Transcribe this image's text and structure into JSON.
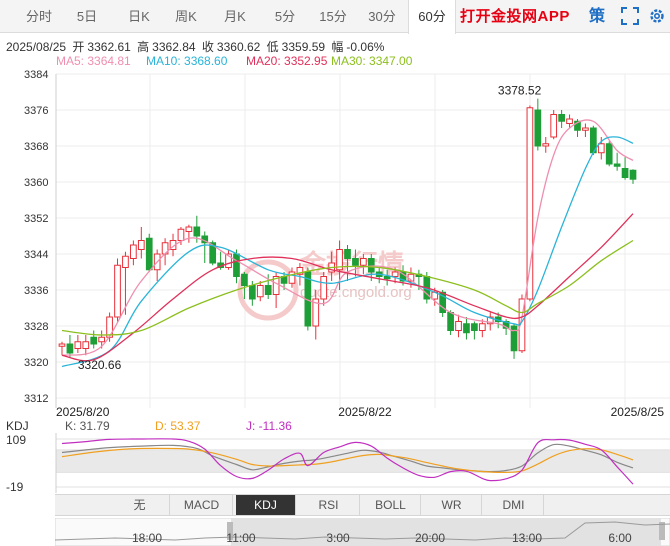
{
  "tabs": [
    {
      "label": "分时",
      "active": false
    },
    {
      "label": "5日",
      "active": false
    },
    {
      "label": "日K",
      "active": false
    },
    {
      "label": "周K",
      "active": false
    },
    {
      "label": "月K",
      "active": false
    },
    {
      "label": "5分",
      "active": false
    },
    {
      "label": "15分",
      "active": false
    },
    {
      "label": "30分",
      "active": false
    },
    {
      "label": "60分",
      "active": true
    }
  ],
  "header": {
    "app_link": "打开金投网APP",
    "strategy": "策",
    "fullscreen_icon": "fullscreen-icon",
    "settings_icon": "gear-icon"
  },
  "quote": {
    "date": "2025/08/25",
    "open_label": "开",
    "open": "3362.61",
    "high_label": "高",
    "high": "3362.84",
    "close_label": "收",
    "close": "3360.62",
    "low_label": "低",
    "low": "3359.59",
    "change_label": "幅",
    "change": "-0.06%"
  },
  "ma": [
    {
      "label": "MA5: 3364.81",
      "color": "#ef8fb0"
    },
    {
      "label": "MA10: 3368.60",
      "color": "#2ab4d8"
    },
    {
      "label": "MA20: 3352.95",
      "color": "#e0305a"
    },
    {
      "label": "MA30: 3347.00",
      "color": "#8cbf1e"
    }
  ],
  "watermark": {
    "text1": "金投行情",
    "text2": "quote.cngold.org"
  },
  "kdj": {
    "title": "KDJ",
    "k": "K: 31.79",
    "k_color": "#888888",
    "d": "D: 53.37",
    "d_color": "#f0a020",
    "j": "J: -11.36",
    "j_color": "#c030c0",
    "ymax": "109",
    "ymin": "-19"
  },
  "indicators": [
    {
      "label": "无",
      "active": false
    },
    {
      "label": "MACD",
      "active": false
    },
    {
      "label": "KDJ",
      "active": true
    },
    {
      "label": "RSI",
      "active": false
    },
    {
      "label": "BOLL",
      "active": false
    },
    {
      "label": "WR",
      "active": false
    },
    {
      "label": "DMI",
      "active": false
    }
  ],
  "nav_arrows": {
    "up": "▲",
    "down": "▼"
  },
  "navigator_times": [
    "18:00",
    "11:00",
    "3:00",
    "20:00",
    "13:00",
    "6:00"
  ],
  "chart_data": {
    "type": "candlestick",
    "y_ticks": [
      3384,
      3376,
      3368,
      3360,
      3352,
      3344,
      3336,
      3328,
      3320,
      3312
    ],
    "ylim": [
      3312,
      3384
    ],
    "x_labels": [
      "2025/8/20",
      "2025/8/22",
      "2025/8/25"
    ],
    "max_label": "3378.52",
    "min_label": "3320.66",
    "colors": {
      "up": "#e8303a",
      "down": "#1e9e36"
    },
    "candles": [
      [
        3323.5,
        3324.0,
        3321.5,
        3324.5
      ],
      [
        3324.0,
        3322.0,
        3321.0,
        3326.0
      ],
      [
        3323.0,
        3324.5,
        3322.0,
        3326.0
      ],
      [
        3323.0,
        3324.5,
        3321.5,
        3326.0
      ],
      [
        3325.5,
        3324.0,
        3323.0,
        3327.0
      ],
      [
        3324.5,
        3325.5,
        3323.0,
        3327.0
      ],
      [
        3325.5,
        3330.0,
        3324.5,
        3331.0
      ],
      [
        3330.0,
        3341.5,
        3329.0,
        3343.0
      ],
      [
        3341.0,
        3343.5,
        3330.5,
        3344.5
      ],
      [
        3343.0,
        3346.0,
        3341.5,
        3347.0
      ],
      [
        3345.0,
        3347.0,
        3343.0,
        3350.0
      ],
      [
        3347.5,
        3340.5,
        3340.0,
        3348.5
      ],
      [
        3340.5,
        3344.0,
        3338.0,
        3345.0
      ],
      [
        3344.0,
        3346.5,
        3341.5,
        3347.5
      ],
      [
        3345.0,
        3347.0,
        3343.5,
        3348.5
      ],
      [
        3347.0,
        3349.5,
        3346.0,
        3350.0
      ],
      [
        3349.0,
        3350.0,
        3346.5,
        3350.5
      ],
      [
        3350.0,
        3348.0,
        3346.5,
        3352.5
      ],
      [
        3348.0,
        3346.5,
        3342.0,
        3349.0
      ],
      [
        3346.5,
        3342.0,
        3341.5,
        3347.0
      ],
      [
        3342.0,
        3341.0,
        3340.5,
        3344.5
      ],
      [
        3341.0,
        3344.0,
        3340.5,
        3345.0
      ],
      [
        3344.0,
        3339.0,
        3337.5,
        3345.0
      ],
      [
        3339.5,
        3337.0,
        3334.0,
        3340.0
      ],
      [
        3337.0,
        3334.0,
        3332.5,
        3338.0
      ],
      [
        3334.5,
        3337.0,
        3333.5,
        3338.0
      ],
      [
        3337.0,
        3335.0,
        3334.0,
        3339.5
      ],
      [
        3335.0,
        3339.0,
        3332.0,
        3340.0
      ],
      [
        3339.0,
        3337.5,
        3336.0,
        3340.0
      ],
      [
        3337.5,
        3340.0,
        3336.5,
        3341.0
      ],
      [
        3339.5,
        3341.0,
        3337.0,
        3342.0
      ],
      [
        3340.0,
        3328.0,
        3327.0,
        3341.0
      ],
      [
        3328.0,
        3334.0,
        3325.0,
        3336.0
      ],
      [
        3334.0,
        3339.0,
        3332.5,
        3340.0
      ],
      [
        3340.0,
        3342.0,
        3338.0,
        3344.5
      ],
      [
        3340.5,
        3345.0,
        3336.0,
        3347.0
      ],
      [
        3345.0,
        3343.0,
        3338.0,
        3346.0
      ],
      [
        3343.0,
        3341.5,
        3339.0,
        3345.0
      ],
      [
        3341.5,
        3343.0,
        3339.5,
        3344.0
      ],
      [
        3343.0,
        3340.0,
        3338.0,
        3344.0
      ],
      [
        3340.0,
        3339.0,
        3337.5,
        3341.0
      ],
      [
        3339.0,
        3338.5,
        3337.0,
        3340.5
      ],
      [
        3339.0,
        3340.0,
        3337.5,
        3341.0
      ],
      [
        3340.0,
        3338.0,
        3337.0,
        3341.5
      ],
      [
        3338.0,
        3339.5,
        3336.5,
        3341.0
      ],
      [
        3339.5,
        3339.0,
        3336.0,
        3340.5
      ],
      [
        3339.0,
        3334.0,
        3333.0,
        3340.0
      ],
      [
        3334.0,
        3335.5,
        3332.5,
        3336.5
      ],
      [
        3335.5,
        3331.0,
        3330.0,
        3336.0
      ],
      [
        3331.0,
        3327.0,
        3326.0,
        3331.5
      ],
      [
        3327.0,
        3329.0,
        3325.5,
        3330.5
      ],
      [
        3328.5,
        3326.5,
        3325.0,
        3330.0
      ],
      [
        3328.5,
        3327.0,
        3325.0,
        3329.0
      ],
      [
        3327.0,
        3328.5,
        3325.5,
        3329.5
      ],
      [
        3328.5,
        3330.0,
        3327.0,
        3331.0
      ],
      [
        3330.0,
        3329.0,
        3327.5,
        3331.0
      ],
      [
        3329.0,
        3327.5,
        3326.0,
        3329.5
      ],
      [
        3328.0,
        3322.5,
        3320.7,
        3328.5
      ],
      [
        3322.5,
        3334.0,
        3322.0,
        3335.0
      ],
      [
        3334.0,
        3376.5,
        3333.5,
        3377.0
      ],
      [
        3376.0,
        3368.0,
        3367.0,
        3378.52
      ],
      [
        3368.0,
        3368.5,
        3366.5,
        3370.0
      ],
      [
        3370.0,
        3375.0,
        3369.5,
        3376.0
      ],
      [
        3375.0,
        3373.5,
        3372.0,
        3376.0
      ],
      [
        3373.0,
        3374.0,
        3372.0,
        3375.0
      ],
      [
        3373.5,
        3371.5,
        3370.0,
        3374.0
      ],
      [
        3371.5,
        3372.0,
        3370.0,
        3373.0
      ],
      [
        3372.0,
        3366.5,
        3366.0,
        3372.5
      ],
      [
        3366.5,
        3368.5,
        3365.0,
        3370.0
      ],
      [
        3368.5,
        3364.0,
        3363.5,
        3369.0
      ],
      [
        3364.0,
        3363.5,
        3362.5,
        3366.5
      ],
      [
        3363.0,
        3361.0,
        3360.5,
        3365.5
      ],
      [
        3362.61,
        3360.62,
        3359.59,
        3362.84
      ]
    ],
    "ma_series": [
      {
        "name": "MA5",
        "color": "#ef8fb0",
        "values": [
          [
            0,
            3321.5
          ],
          [
            5,
            3323.5
          ],
          [
            10,
            3338
          ],
          [
            16,
            3347.5
          ],
          [
            22,
            3342.5
          ],
          [
            27,
            3337.5
          ],
          [
            33,
            3333
          ],
          [
            36,
            3340
          ],
          [
            42,
            3340.5
          ],
          [
            49,
            3331
          ],
          [
            55,
            3328.5
          ],
          [
            57,
            3327
          ],
          [
            58,
            3330
          ],
          [
            60,
            3352
          ],
          [
            62,
            3366
          ],
          [
            64,
            3372
          ],
          [
            67,
            3373.5
          ],
          [
            70,
            3367
          ],
          [
            72,
            3364.81
          ]
        ]
      },
      {
        "name": "MA10",
        "color": "#2ab4d8",
        "values": [
          [
            0,
            3319
          ],
          [
            6,
            3322.5
          ],
          [
            10,
            3333.5
          ],
          [
            16,
            3344.5
          ],
          [
            20,
            3345.5
          ],
          [
            26,
            3340.5
          ],
          [
            30,
            3339
          ],
          [
            34,
            3337.5
          ],
          [
            40,
            3339.5
          ],
          [
            47,
            3335.5
          ],
          [
            52,
            3331
          ],
          [
            57,
            3328.5
          ],
          [
            58,
            3329
          ],
          [
            60,
            3336
          ],
          [
            63,
            3350
          ],
          [
            66,
            3363
          ],
          [
            68,
            3369
          ],
          [
            70,
            3370
          ],
          [
            72,
            3368.6
          ]
        ]
      },
      {
        "name": "MA20",
        "color": "#e0305a",
        "values": [
          [
            0,
            3321.5
          ],
          [
            4,
            3320.5
          ],
          [
            9,
            3326.5
          ],
          [
            14,
            3334
          ],
          [
            19,
            3340.5
          ],
          [
            24,
            3343
          ],
          [
            29,
            3343
          ],
          [
            34,
            3340.5
          ],
          [
            40,
            3338.5
          ],
          [
            46,
            3336.5
          ],
          [
            52,
            3332.5
          ],
          [
            56,
            3330
          ],
          [
            58,
            3330
          ],
          [
            60,
            3332.5
          ],
          [
            64,
            3339
          ],
          [
            68,
            3345.5
          ],
          [
            72,
            3352.95
          ]
        ]
      },
      {
        "name": "MA30",
        "color": "#8cbf1e",
        "values": [
          [
            0,
            3327
          ],
          [
            5,
            3326
          ],
          [
            10,
            3327
          ],
          [
            16,
            3332
          ],
          [
            22,
            3336
          ],
          [
            28,
            3339
          ],
          [
            34,
            3341
          ],
          [
            40,
            3341
          ],
          [
            46,
            3339
          ],
          [
            52,
            3336
          ],
          [
            56,
            3332.5
          ],
          [
            58,
            3331
          ],
          [
            60,
            3333
          ],
          [
            64,
            3337
          ],
          [
            68,
            3342.5
          ],
          [
            72,
            3347.0
          ]
        ]
      }
    ],
    "kdj_series": [
      {
        "name": "K",
        "color": "#888888",
        "values": [
          [
            0,
            73
          ],
          [
            3,
            80
          ],
          [
            6,
            86
          ],
          [
            10,
            90
          ],
          [
            14,
            92
          ],
          [
            17,
            84
          ],
          [
            19,
            64
          ],
          [
            22,
            41
          ],
          [
            24,
            27
          ],
          [
            26,
            35
          ],
          [
            28,
            44
          ],
          [
            30,
            50
          ],
          [
            32,
            54
          ],
          [
            34,
            62
          ],
          [
            36,
            71
          ],
          [
            38,
            79
          ],
          [
            40,
            74
          ],
          [
            42,
            62
          ],
          [
            44,
            50
          ],
          [
            46,
            37
          ],
          [
            48,
            32
          ],
          [
            50,
            27
          ],
          [
            52,
            24
          ],
          [
            54,
            22
          ],
          [
            56,
            25
          ],
          [
            58,
            37
          ],
          [
            60,
            72
          ],
          [
            62,
            94
          ],
          [
            64,
            90
          ],
          [
            66,
            79
          ],
          [
            68,
            67
          ],
          [
            70,
            47
          ],
          [
            72,
            31.79
          ]
        ]
      },
      {
        "name": "D",
        "color": "#f0a020",
        "values": [
          [
            0,
            62
          ],
          [
            4,
            74
          ],
          [
            8,
            82
          ],
          [
            12,
            84
          ],
          [
            16,
            82
          ],
          [
            19,
            72
          ],
          [
            22,
            55
          ],
          [
            24,
            41
          ],
          [
            26,
            37
          ],
          [
            28,
            38
          ],
          [
            30,
            40
          ],
          [
            32,
            42
          ],
          [
            34,
            48
          ],
          [
            36,
            57
          ],
          [
            38,
            65
          ],
          [
            40,
            68
          ],
          [
            42,
            63
          ],
          [
            44,
            56
          ],
          [
            46,
            46
          ],
          [
            48,
            37
          ],
          [
            50,
            29
          ],
          [
            52,
            24
          ],
          [
            54,
            21
          ],
          [
            56,
            20
          ],
          [
            58,
            24
          ],
          [
            60,
            42
          ],
          [
            62,
            64
          ],
          [
            64,
            78
          ],
          [
            66,
            83
          ],
          [
            68,
            80
          ],
          [
            70,
            68
          ],
          [
            72,
            53.37
          ]
        ]
      },
      {
        "name": "J",
        "color": "#c030c0",
        "values": [
          [
            0,
            97
          ],
          [
            3,
            102
          ],
          [
            6,
            108
          ],
          [
            10,
            109
          ],
          [
            14,
            109
          ],
          [
            16,
            103
          ],
          [
            18,
            82
          ],
          [
            20,
            38
          ],
          [
            22,
            9
          ],
          [
            24,
            4
          ],
          [
            26,
            26
          ],
          [
            28,
            56
          ],
          [
            30,
            71
          ],
          [
            31,
            38
          ],
          [
            33,
            73
          ],
          [
            35,
            88
          ],
          [
            37,
            100
          ],
          [
            39,
            90
          ],
          [
            41,
            58
          ],
          [
            43,
            32
          ],
          [
            45,
            12
          ],
          [
            47,
            7
          ],
          [
            49,
            22
          ],
          [
            51,
            23
          ],
          [
            53,
            4
          ],
          [
            54,
            -2
          ],
          [
            56,
            3
          ],
          [
            58,
            26
          ],
          [
            60,
            99
          ],
          [
            62,
            107
          ],
          [
            64,
            106
          ],
          [
            66,
            95
          ],
          [
            68,
            80
          ],
          [
            70,
            35
          ],
          [
            72,
            -11.36
          ]
        ]
      }
    ]
  }
}
